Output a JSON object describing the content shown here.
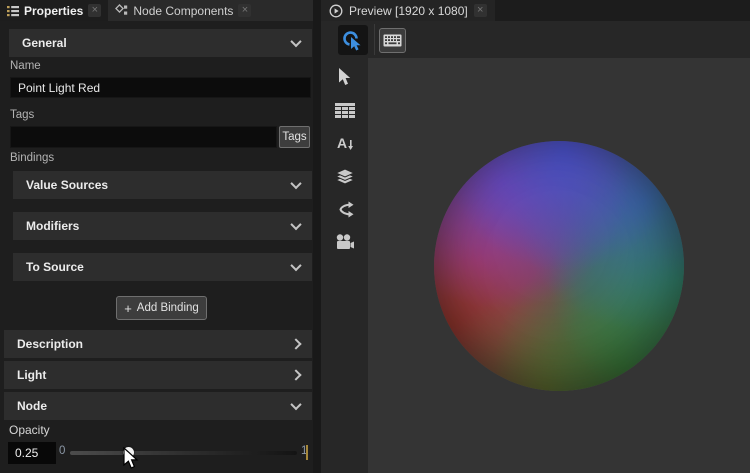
{
  "ui": {
    "close_glyph": "×"
  },
  "left_panel": {
    "tabs": [
      {
        "label": "Properties"
      },
      {
        "label": "Node Components"
      }
    ],
    "general": {
      "label": "General"
    },
    "name": {
      "label": "Name",
      "value": "Point Light Red"
    },
    "tags": {
      "label": "Tags",
      "value": "",
      "placeholder": "",
      "button_label": "Tags"
    },
    "bindings": {
      "label": "Bindings",
      "value_sources_label": "Value Sources",
      "modifiers_label": "Modifiers",
      "to_source_label": "To Source",
      "add_binding_plus": "+",
      "add_binding_label": "Add Binding"
    },
    "description": {
      "label": "Description"
    },
    "light": {
      "label": "Light"
    },
    "node": {
      "label": "Node"
    },
    "opacity": {
      "label": "Opacity",
      "value": "0.25",
      "min": "0",
      "max": "1",
      "percent": 25.5
    }
  },
  "preview_panel": {
    "tab": {
      "label": "Preview [1920 x 1080]"
    },
    "toolbar": {
      "interact_tool": "interact-cursor-tool",
      "keyboard_tool": "virtual-keyboard-tool"
    },
    "side_toolbar": [
      "select-arrow",
      "grid-table",
      "text-tool",
      "layers",
      "route-branch",
      "camera"
    ]
  },
  "colors": {
    "accent_blue": "#3d8fe0",
    "panel_bg": "#1e1e1e",
    "section_header_bg": "#2d2d2d",
    "viewport_bg": "#343434",
    "input_bg": "#0c0c0c",
    "slider_marker_amber": "#a5873a",
    "sphere_palette": [
      "#4850c8",
      "#7a42be",
      "#346ca8",
      "#329658",
      "#3a7e30",
      "#766c28",
      "#983628",
      "#ba3672"
    ]
  }
}
